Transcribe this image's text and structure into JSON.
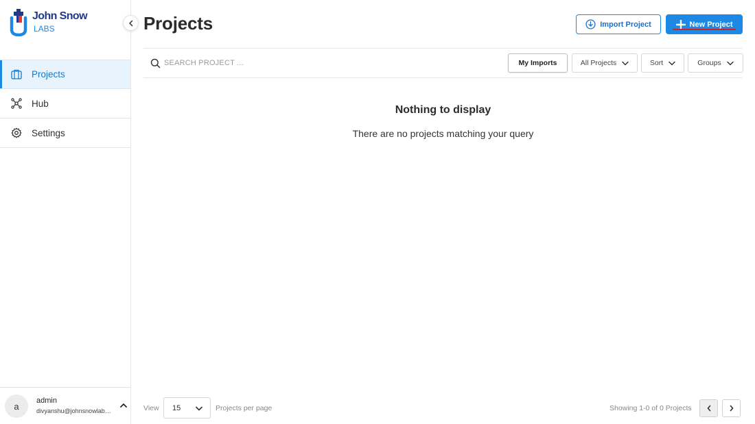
{
  "brand": {
    "line1": "John Snow",
    "line2": "LABS",
    "color_primary": "#1e88e5",
    "color_dark": "#1f3a8a"
  },
  "sidebar": {
    "items": [
      {
        "label": "Projects",
        "icon": "projects-icon",
        "active": true
      },
      {
        "label": "Hub",
        "icon": "hub-icon",
        "active": false
      },
      {
        "label": "Settings",
        "icon": "gear-icon",
        "active": false
      }
    ],
    "user": {
      "initial": "a",
      "name": "admin",
      "email": "divyanshu@johnsnowlabs.com"
    }
  },
  "header": {
    "title": "Projects",
    "import_label": "Import Project",
    "new_label": "New Project"
  },
  "toolbar": {
    "search_placeholder": "SEARCH PROJECT ...",
    "my_imports": "My Imports",
    "all_projects": "All Projects",
    "sort": "Sort",
    "groups": "Groups"
  },
  "empty": {
    "title": "Nothing to display",
    "text": "There are no projects matching your query"
  },
  "footer": {
    "view_label": "View",
    "per_page_value": "15",
    "per_page_label": "Projects per page",
    "showing": "Showing 1-0 of 0 Projects"
  }
}
